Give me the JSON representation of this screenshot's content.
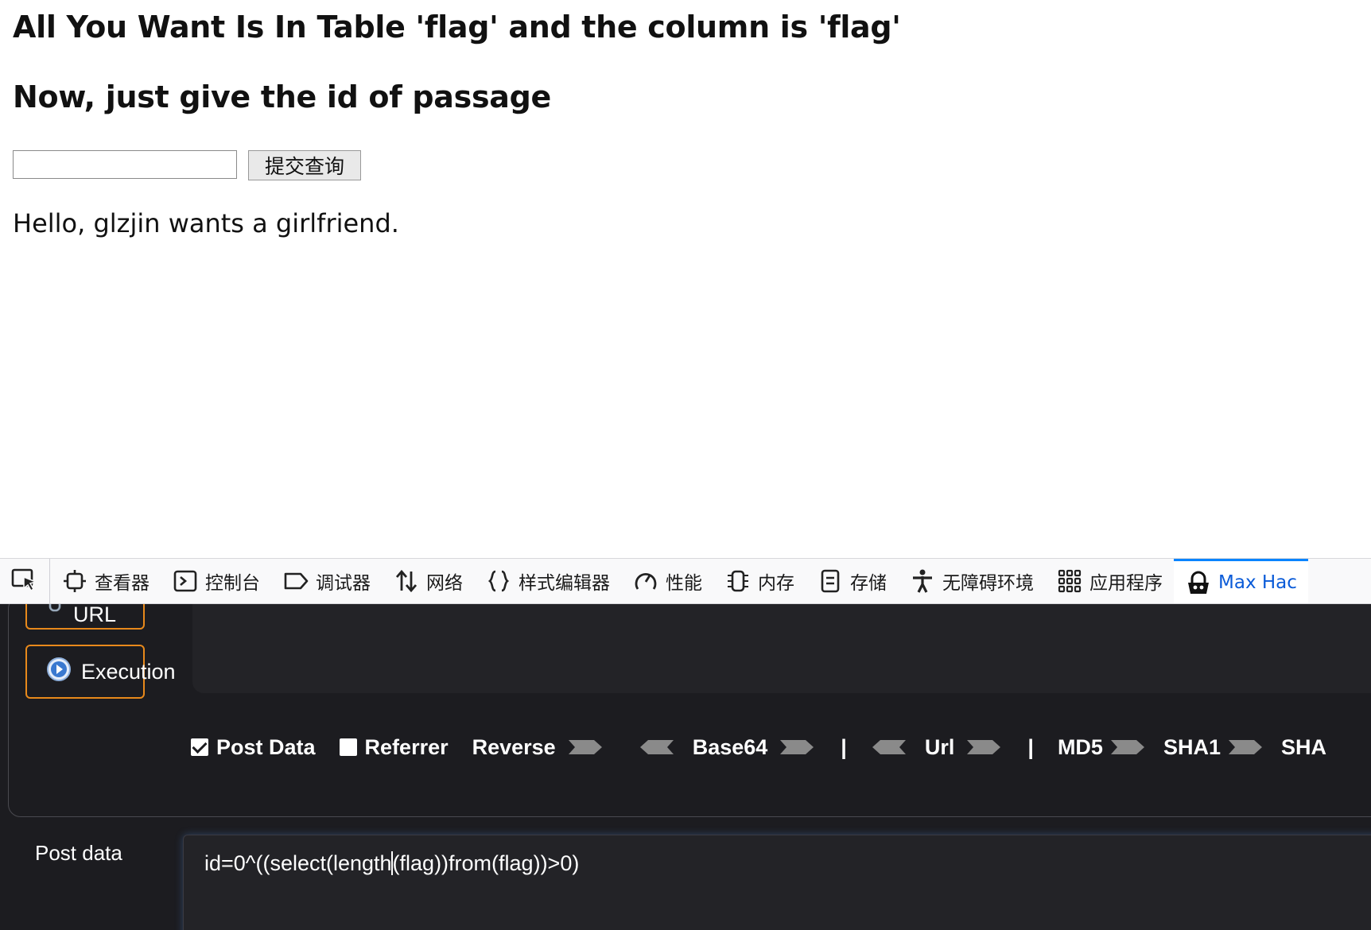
{
  "page": {
    "heading1": "All You Want Is In Table 'flag' and the column is 'flag'",
    "heading2": "Now, just give the id of passage",
    "input_value": "",
    "submit_label": "提交查询",
    "message": "Hello, glzjin wants a girlfriend."
  },
  "devtools": {
    "tabs": [
      {
        "label": "查看器",
        "icon": "inspector-icon"
      },
      {
        "label": "控制台",
        "icon": "console-icon"
      },
      {
        "label": "调试器",
        "icon": "debugger-icon"
      },
      {
        "label": "网络",
        "icon": "network-icon"
      },
      {
        "label": "样式编辑器",
        "icon": "style-editor-icon"
      },
      {
        "label": "性能",
        "icon": "performance-icon"
      },
      {
        "label": "内存",
        "icon": "memory-icon"
      },
      {
        "label": "存储",
        "icon": "storage-icon"
      },
      {
        "label": "无障碍环境",
        "icon": "accessibility-icon"
      },
      {
        "label": "应用程序",
        "icon": "application-icon"
      },
      {
        "label": "Max Hac",
        "icon": "hackbar-icon",
        "active": true
      }
    ],
    "active_color": "#0a84ff"
  },
  "hackbar": {
    "split_url_label": "Spit URL",
    "execution_label": "Execution",
    "post_data_checkbox_label": "Post Data",
    "post_data_checked": true,
    "referrer_checkbox_label": "Referrer",
    "referrer_checked": false,
    "reverse_label": "Reverse",
    "base64_label": "Base64",
    "separator": "|",
    "url_label": "Url",
    "md5_label": "MD5",
    "sha1_label": "SHA1",
    "sha_label": "SHA",
    "post_data_label": "Post data",
    "post_data_before_caret": "id=0^((select(length",
    "post_data_after_caret": "(flag))from(flag))>0)",
    "accent_color": "#e8891b"
  }
}
